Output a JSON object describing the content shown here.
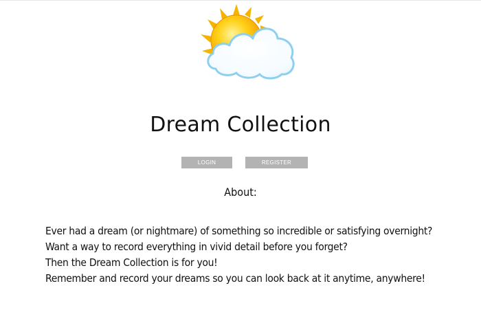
{
  "header": {
    "logo_icon": "sun-behind-cloud-icon",
    "title": "Dream Collection"
  },
  "auth": {
    "login_label": "LOGIN",
    "register_label": "REGISTER",
    "button_color": "#b3b3b3"
  },
  "about": {
    "heading": "About:",
    "lines": [
      "Ever had a dream (or nightmare) of something so incredible or satisfying overnight?",
      "Want a way to record everything in vivid detail before you forget?",
      "Then the Dream Collection is for you!",
      "Remember and record your dreams so you can look back at it anytime, anywhere!"
    ]
  },
  "colors": {
    "sun_core": "#f7c600",
    "sun_rays": "#f4b400",
    "cloud_outline": "#8ecfee",
    "cloud_fill": "#ffffff"
  }
}
